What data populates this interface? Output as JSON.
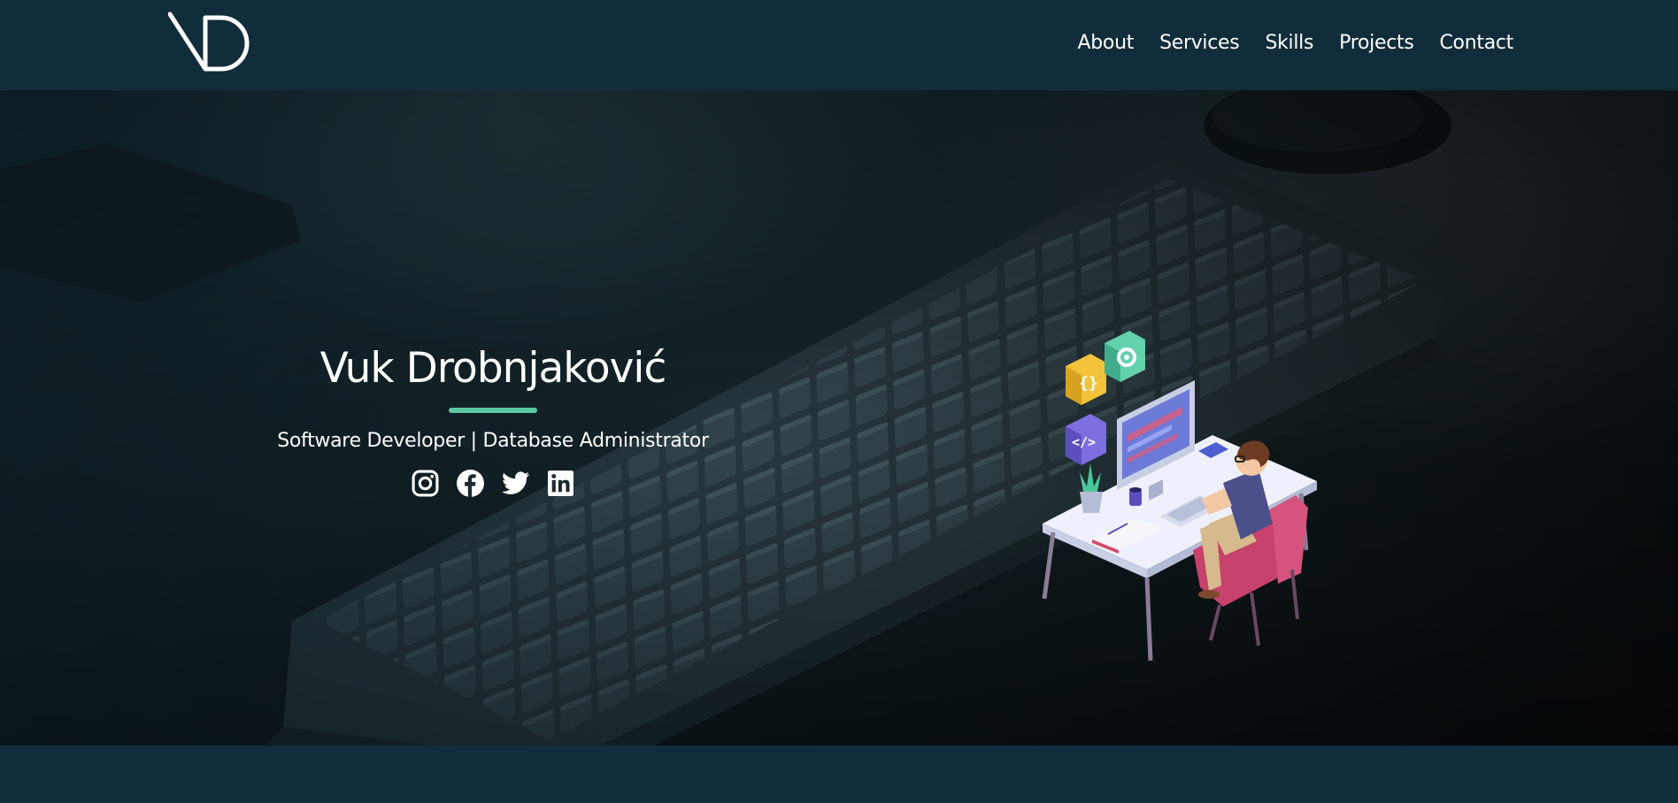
{
  "brand": {
    "logo_icon": "vd-monogram-logo"
  },
  "nav": {
    "items": [
      "About",
      "Services",
      "Skills",
      "Projects",
      "Contact"
    ]
  },
  "hero": {
    "name": "Vuk Drobnjaković",
    "role": "Software Developer | Database Administrator",
    "socials": [
      "instagram-icon",
      "facebook-icon",
      "twitter-icon",
      "linkedin-icon"
    ],
    "accent_color": "#5cc8a6"
  },
  "colors": {
    "navbar": "#112d3b",
    "text": "#ffffff",
    "accent": "#5cc8a6"
  }
}
